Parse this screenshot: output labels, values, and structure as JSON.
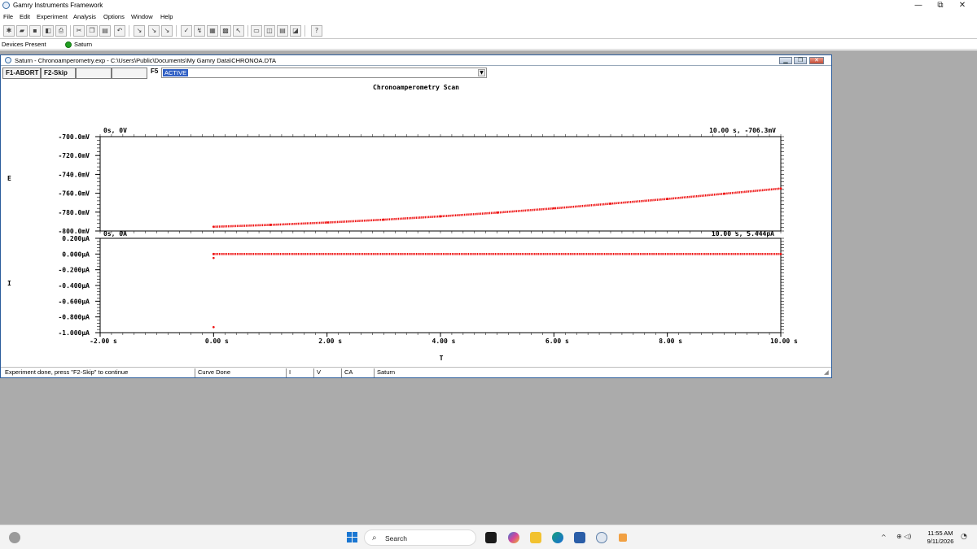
{
  "app": {
    "title": "Gamry Instruments Framework",
    "controls": {
      "minimize": "—",
      "maximize": "⧉",
      "close": "✕"
    }
  },
  "menu": [
    "File",
    "Edit",
    "Experiment",
    "Analysis",
    "Options",
    "Window",
    "Help"
  ],
  "toolbar": {
    "icons": [
      "new-icon",
      "open-icon",
      "save-icon",
      "close-file-icon",
      "print-icon",
      "cut-icon",
      "copy-icon",
      "paste-icon",
      "undo-icon",
      "tool-a-icon",
      "tool-b-icon",
      "tool-c-icon",
      "check-icon",
      "run-icon",
      "data-icon",
      "cursor-icon",
      "layout-a-icon",
      "layout-b-icon",
      "layout-c-icon",
      "layout-d-icon",
      "help-icon"
    ]
  },
  "devices": {
    "label": "Devices Present",
    "device": "Saturn",
    "status_color": "#21a021"
  },
  "child": {
    "title": "Saturn - Chronoamperometry.exp - C:\\Users\\Public\\Documents\\My Gamry Data\\CHRONOA.DTA",
    "fkeys": {
      "f1": "F1-ABORT",
      "f2": "F2-Skip",
      "f5_label": "F5",
      "f5_value": "ACTIVE"
    },
    "status": {
      "message": "Experiment done, press \"F2-Skip\" to continue",
      "curve": "Curve Done",
      "i": "I",
      "v": "V",
      "mode": "CA",
      "device": "Saturn"
    }
  },
  "chart_data": {
    "type": "scatter",
    "title": "Chronoamperometry Scan",
    "xlabel": "T",
    "x_ticks": [
      "-2.00 s",
      "0.00 s",
      "2.00 s",
      "4.00 s",
      "6.00 s",
      "8.00 s",
      "10.00 s"
    ],
    "xlim": [
      -2,
      10
    ],
    "color": "#ee1111",
    "panels": [
      {
        "name": "E",
        "ylabel": "E",
        "ylim": [
          -800,
          -700
        ],
        "y_ticks": [
          "-700.0mV",
          "-720.0mV",
          "-740.0mV",
          "-760.0mV",
          "-780.0mV",
          "-800.0mV"
        ],
        "start_annotation": "0s, 0V",
        "end_annotation": "10.00 s, -706.3mV",
        "series": [
          {
            "x": [
              0.0,
              1.0,
              2.0,
              3.0,
              4.0,
              5.0,
              6.0,
              7.0,
              8.0,
              9.0,
              10.0
            ],
            "y": [
              -795.5,
              -793.5,
              -791.0,
              -788.0,
              -784.5,
              -780.5,
              -776.0,
              -771.0,
              -766.0,
              -760.5,
              -755.0
            ]
          }
        ]
      },
      {
        "name": "I",
        "ylabel": "I",
        "ylim": [
          -1.0,
          0.2
        ],
        "y_ticks": [
          "0.200µA",
          "0.000µA",
          "-0.200µA",
          "-0.400µA",
          "-0.600µA",
          "-0.800µA",
          "-1.000µA"
        ],
        "start_annotation": "0s, 0A",
        "end_annotation": "10.00 s, 5.444pA",
        "series": [
          {
            "x": [
              0.0,
              10.0
            ],
            "y": [
              0.0,
              0.0
            ]
          }
        ],
        "outliers": [
          {
            "x": 0.0,
            "y": -0.05
          },
          {
            "x": 0.0,
            "y": -0.93
          }
        ]
      }
    ]
  },
  "taskbar": {
    "search_placeholder": "Search",
    "time": "11:55 AM",
    "date": "9/11/2026",
    "apps": [
      "terminal-icon",
      "copilot-icon",
      "file-explorer-icon",
      "edge-icon",
      "store-icon",
      "gamry-icon",
      "tool-icon"
    ]
  }
}
